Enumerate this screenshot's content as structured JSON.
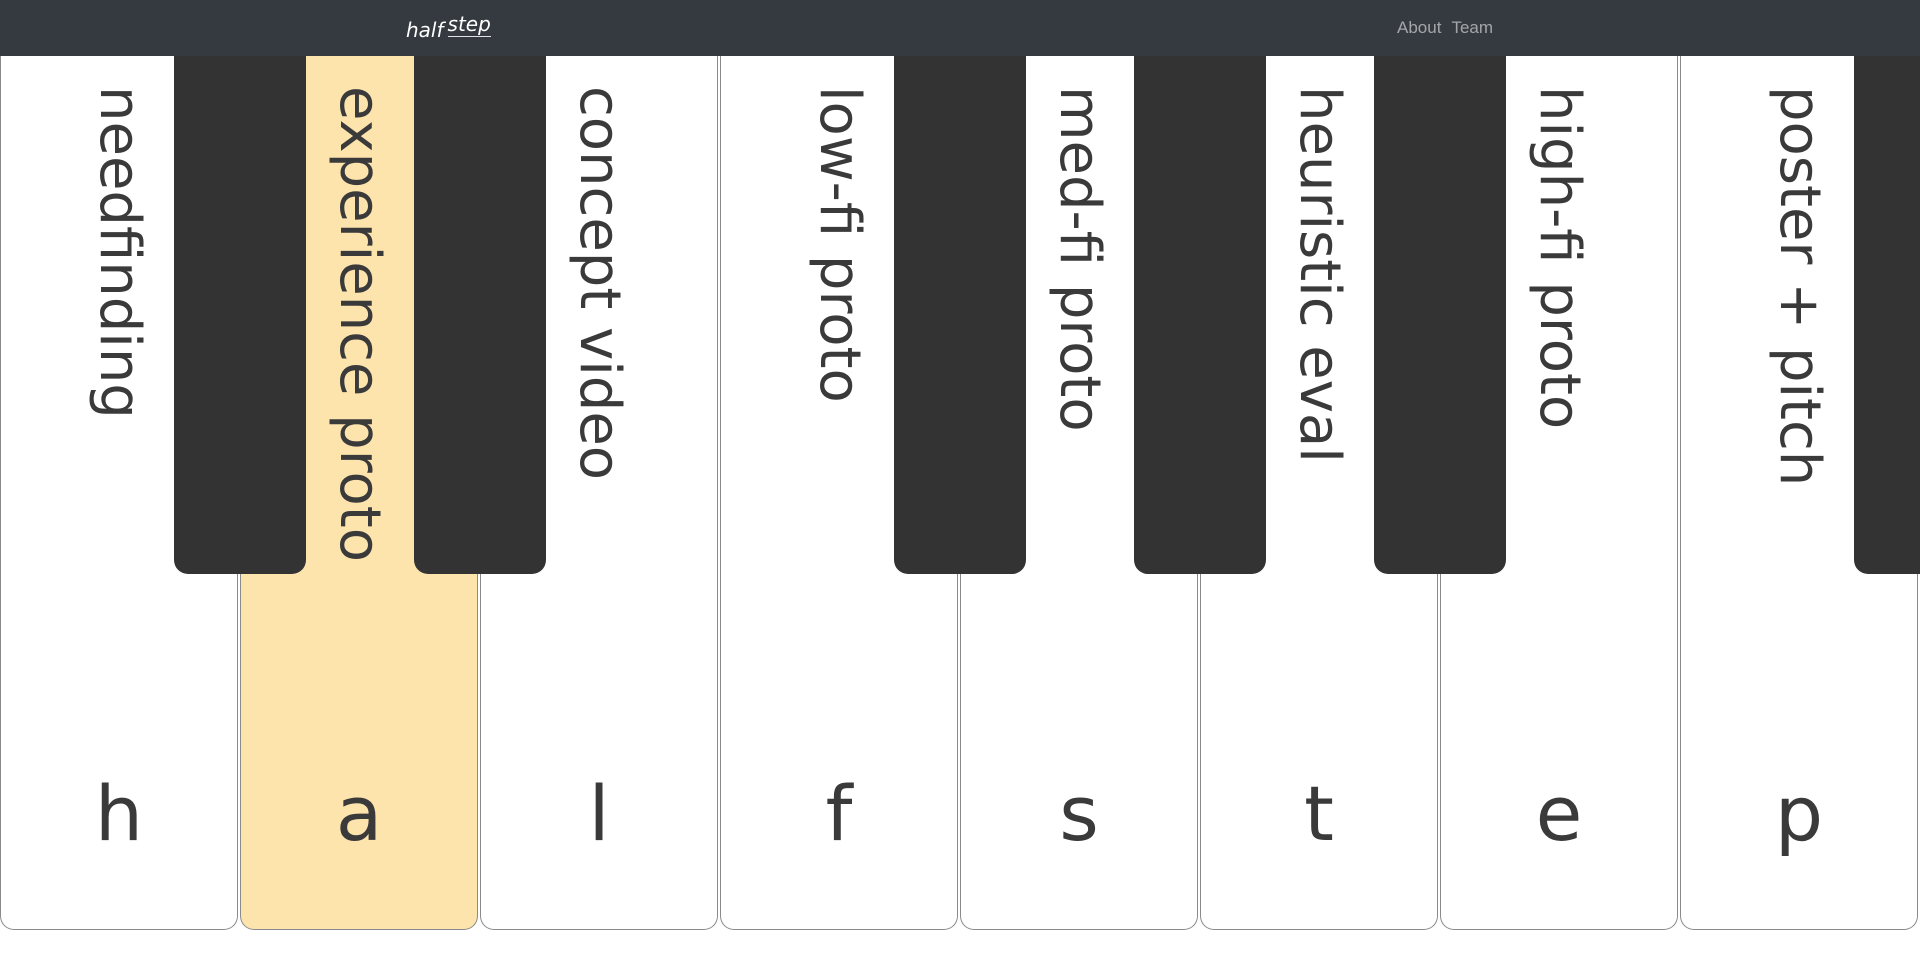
{
  "navbar": {
    "brand_part1": "half",
    "brand_part2": "step",
    "links": [
      "About",
      "Team"
    ]
  },
  "keys": [
    {
      "label": "needfinding",
      "letter": "h",
      "active": false
    },
    {
      "label": "experience proto",
      "letter": "a",
      "active": true
    },
    {
      "label": "concept video",
      "letter": "l",
      "active": false
    },
    {
      "label": "low-fi proto",
      "letter": "f",
      "active": false
    },
    {
      "label": "med-fi proto",
      "letter": "s",
      "active": false
    },
    {
      "label": "heuristic eval",
      "letter": "t",
      "active": false
    },
    {
      "label": "high-fi proto",
      "letter": "e",
      "active": false
    },
    {
      "label": "poster + pitch",
      "letter": "p",
      "active": false
    }
  ],
  "colors": {
    "navbar": "#343a40",
    "white_key": "#ffffff",
    "active_key": "#fde4ad",
    "black_key": "#333333",
    "text": "#3a3a3a"
  }
}
